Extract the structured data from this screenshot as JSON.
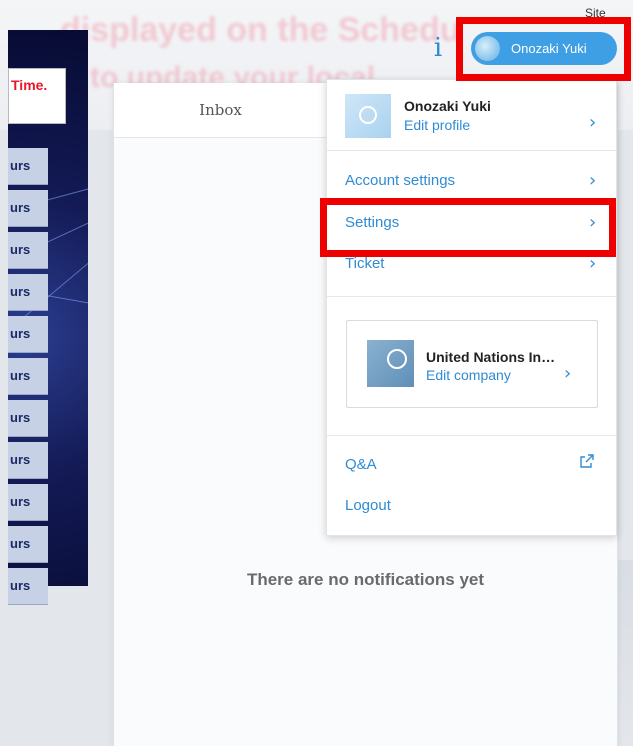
{
  "background": {
    "banner_line1": "displayed on the Schedu",
    "banner_line2": "to update your local",
    "left_notice": "Time.",
    "left_items": [
      "urs",
      "urs",
      "urs",
      "urs",
      "urs",
      "urs",
      "urs",
      "urs",
      "urs",
      "urs",
      "urs"
    ]
  },
  "header": {
    "top_label": "Site",
    "info_icon": "i",
    "user_name": "Onozaki Yuki"
  },
  "notifications": {
    "tab_label": "Inbox",
    "empty_message": "There are no notifications yet"
  },
  "menu": {
    "profile_name": "Onozaki Yuki",
    "profile_edit": "Edit profile",
    "account_settings": "Account settings",
    "settings": "Settings",
    "ticket": "Ticket",
    "company_name": "United Nations In…",
    "company_edit": "Edit company",
    "qa": "Q&A",
    "logout": "Logout",
    "chevron": "›"
  },
  "colors": {
    "accent": "#2f8bd3",
    "user_button": "#3e9fe4",
    "highlight": "#ee0000"
  }
}
